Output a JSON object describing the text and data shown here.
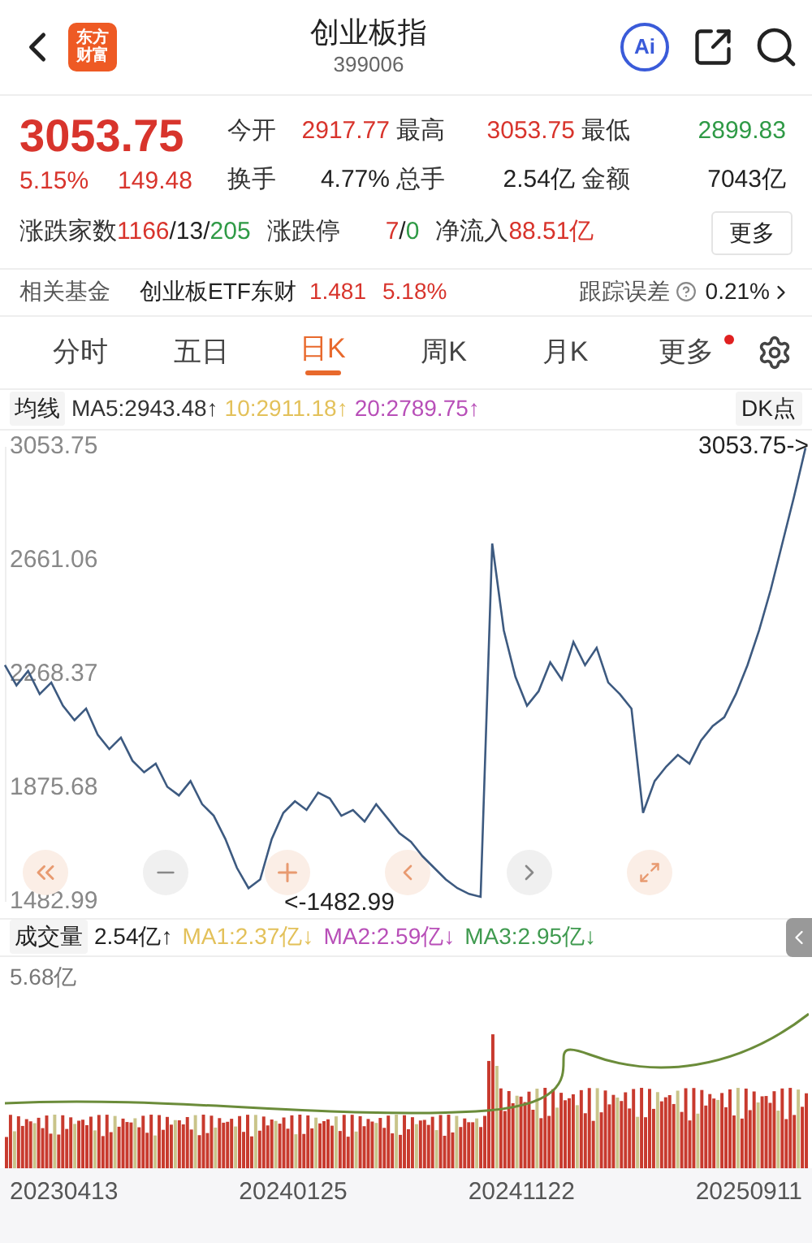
{
  "header": {
    "logo_lines": [
      "东方",
      "财富"
    ],
    "title": "创业板指",
    "code": "399006",
    "ai_label": "Ai"
  },
  "quote": {
    "price": "3053.75",
    "change_pct": "5.15%",
    "change": "149.48",
    "color": "#d8342c",
    "stats": [
      {
        "label": "今开",
        "parts": [
          {
            "text": "2917.77",
            "color": "#d8342c"
          }
        ]
      },
      {
        "label": "最高",
        "parts": [
          {
            "text": "3053.75",
            "color": "#d8342c"
          }
        ]
      },
      {
        "label": "最低",
        "parts": [
          {
            "text": "2899.83",
            "color": "#2f9a46"
          }
        ]
      },
      {
        "label": "换手",
        "parts": [
          {
            "text": "4.77%",
            "color": "#222222"
          }
        ]
      },
      {
        "label": "总手",
        "parts": [
          {
            "text": "2.54亿",
            "color": "#222222"
          }
        ]
      },
      {
        "label": "金额",
        "parts": [
          {
            "text": "7043亿",
            "color": "#222222"
          }
        ]
      }
    ],
    "breadth": [
      {
        "label": "涨跌家数",
        "parts": [
          {
            "text": "1166",
            "color": "#d8342c"
          },
          {
            "text": "/13/",
            "color": "#222222"
          },
          {
            "text": "205",
            "color": "#2f9a46"
          }
        ]
      },
      {
        "label": "涨跌停",
        "parts": [
          {
            "text": "7",
            "color": "#d8342c"
          },
          {
            "text": "/",
            "color": "#222222"
          },
          {
            "text": "0",
            "color": "#2f9a46"
          }
        ]
      },
      {
        "label": "净流入",
        "parts": [
          {
            "text": "88.51亿",
            "color": "#d8342c"
          }
        ]
      }
    ],
    "more_button": "更多"
  },
  "fund": {
    "label": "相关基金",
    "name": "创业板ETF东财",
    "price": "1.481",
    "change_pct": "5.18%",
    "tracking_label": "跟踪误差",
    "tracking_value": "0.21%"
  },
  "tabs": [
    {
      "label": "分时",
      "selected": false,
      "badge": false
    },
    {
      "label": "五日",
      "selected": false,
      "badge": false
    },
    {
      "label": "日K",
      "selected": true,
      "badge": false
    },
    {
      "label": "周K",
      "selected": false,
      "badge": false
    },
    {
      "label": "月K",
      "selected": false,
      "badge": false
    },
    {
      "label": "更多",
      "selected": false,
      "badge": true
    }
  ],
  "ma_legend": {
    "selector": "均线",
    "items": [
      {
        "text": "MA5:2943.48↑",
        "color": "#333333"
      },
      {
        "text": "10:2911.18↑",
        "color": "#e3c15a"
      },
      {
        "text": "20:2789.75↑",
        "color": "#b84fb8"
      }
    ],
    "right_button": "DK点"
  },
  "price_chart": {
    "max_marker": "3053.75->",
    "min_marker": "<-1482.99",
    "chart_data": {
      "type": "line",
      "ylim": [
        1482.99,
        3053.75
      ],
      "yticks": [
        3053.75,
        2661.06,
        2268.37,
        1875.68,
        1482.99
      ],
      "series": [
        {
          "color": "#3d5a80",
          "values": [
            2300,
            2230,
            2280,
            2200,
            2240,
            2160,
            2110,
            2150,
            2060,
            2010,
            2050,
            1970,
            1930,
            1960,
            1880,
            1850,
            1900,
            1820,
            1780,
            1700,
            1600,
            1530,
            1560,
            1700,
            1790,
            1830,
            1800,
            1860,
            1840,
            1780,
            1800,
            1760,
            1820,
            1770,
            1720,
            1690,
            1640,
            1600,
            1560,
            1530,
            1510,
            1500,
            2720,
            2420,
            2260,
            2160,
            2210,
            2310,
            2250,
            2380,
            2300,
            2360,
            2240,
            2200,
            2150,
            1790,
            1900,
            1950,
            1990,
            1960,
            2040,
            2090,
            2120,
            2200,
            2300,
            2420,
            2560,
            2720,
            2880,
            3050
          ]
        }
      ]
    }
  },
  "volume": {
    "selector": "成交量",
    "value": "2.54亿↑",
    "items": [
      {
        "text": "MA1:2.37亿↓",
        "color": "#e3c15a"
      },
      {
        "text": "MA2:2.59亿↓",
        "color": "#b84fb8"
      },
      {
        "text": "MA3:2.95亿↓",
        "color": "#3f9a4f"
      }
    ],
    "max_label": "5.68亿"
  },
  "dates": [
    "20230413",
    "20240125",
    "20241122",
    "20250911"
  ]
}
